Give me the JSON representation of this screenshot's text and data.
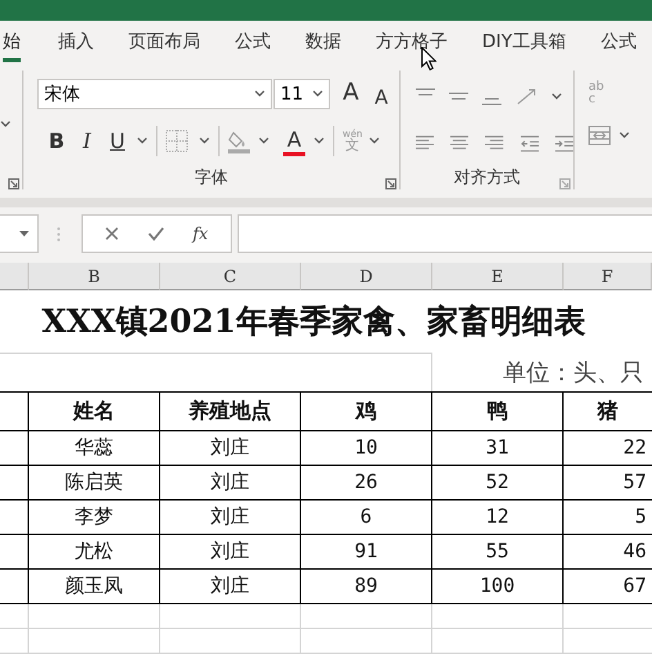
{
  "tabs": [
    {
      "label": "始",
      "selected": true
    },
    {
      "label": "插入",
      "selected": false
    },
    {
      "label": "页面布局",
      "selected": false
    },
    {
      "label": "公式",
      "selected": false
    },
    {
      "label": "数据",
      "selected": false
    },
    {
      "label": "方方格子",
      "selected": false
    },
    {
      "label": "DIY工具箱",
      "selected": false
    },
    {
      "label": "公式",
      "selected": false
    }
  ],
  "ribbon": {
    "font_name": "宋体",
    "font_size": "11",
    "grow_font": "A",
    "shrink_font": "A",
    "format_buttons": [
      "B",
      "I",
      "U"
    ],
    "font_color": {
      "label": "A",
      "color": "#e81123"
    },
    "phonetic": {
      "top": "wén",
      "bottom": "文"
    },
    "wrap_text": {
      "top": "ab",
      "bottom": "c"
    },
    "groups": [
      {
        "label": "字体"
      },
      {
        "label": "对齐方式"
      }
    ]
  },
  "formula_bar": {
    "function_label": "fx"
  },
  "sheet": {
    "columns": [
      "B",
      "C",
      "D",
      "E",
      "F"
    ],
    "title": "XXX镇2021年春季家禽、家畜明细表",
    "unit": "单位：头、只",
    "headers": [
      "姓名",
      "养殖地点",
      "鸡",
      "鸭",
      "猪"
    ],
    "rows": [
      [
        "华蕊",
        "刘庄",
        "10",
        "31",
        "22"
      ],
      [
        "陈启英",
        "刘庄",
        "26",
        "52",
        "57"
      ],
      [
        "李梦",
        "刘庄",
        "6",
        "12",
        "5"
      ],
      [
        "尤松",
        "刘庄",
        "91",
        "55",
        "46"
      ],
      [
        "颜玉凤",
        "刘庄",
        "89",
        "100",
        "67"
      ]
    ]
  }
}
